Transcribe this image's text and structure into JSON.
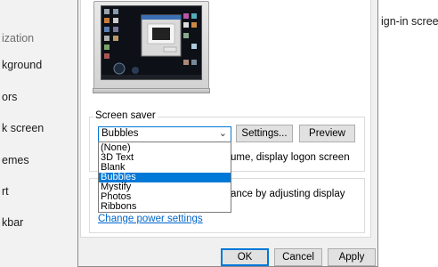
{
  "settings_nav": {
    "header": "ization",
    "items": [
      "kground",
      "ors",
      "k screen",
      "emes",
      "rt",
      "kbar"
    ]
  },
  "right_text": "ign-in screen",
  "dialog": {
    "screen_saver_legend": "Screen saver",
    "selected_saver": "Bubbles",
    "settings_label": "Settings...",
    "preview_label": "Preview",
    "resume_text": "ume, display logon screen",
    "power_text": "ance by adjusting display",
    "power_link": "Change power settings",
    "ok_label": "OK",
    "cancel_label": "Cancel",
    "apply_label": "Apply"
  },
  "dropdown": {
    "options": [
      "(None)",
      "3D Text",
      "Blank",
      "Bubbles",
      "Mystify",
      "Photos",
      "Ribbons"
    ],
    "selected_index": 3
  },
  "colors": {
    "accent": "#0078d7",
    "link": "#0066cc"
  }
}
